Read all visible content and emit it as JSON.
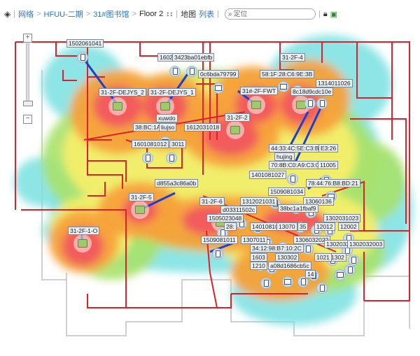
{
  "toolbar": {
    "breadcrumb": [
      {
        "label": "网络"
      },
      {
        "label": "HFUU-二期"
      },
      {
        "label": "31#图书馆"
      },
      {
        "label": "Floor 2"
      }
    ],
    "map_btn": "地图",
    "list_btn": "列表",
    "search_placeholder": "定位"
  },
  "aps": [
    {
      "name": "31-2F-DEJYS_2"
    },
    {
      "name": "31-2F-DEJYS_1"
    },
    {
      "name": "31#-2F-FWT"
    },
    {
      "name": "31-2F-4"
    },
    {
      "name": "31-2F-2"
    },
    {
      "name": "31-2F-5"
    },
    {
      "name": "31-2F-6"
    },
    {
      "name": "31-2F-1-O"
    }
  ],
  "clients": [
    {
      "name": "1502061041"
    },
    {
      "name": "1602"
    },
    {
      "name": "3423ba01ebfb"
    },
    {
      "name": "0c6bda79799"
    },
    {
      "name": "58:1F:28:C6:9E:3B"
    },
    {
      "name": "1314011026"
    },
    {
      "name": "8c18d9cdc10e"
    },
    {
      "name": "xuwdo"
    },
    {
      "name": "38:BC:1A"
    },
    {
      "name": "liujso"
    },
    {
      "name": "1612031018"
    },
    {
      "name": "1601081012"
    },
    {
      "name": "3011"
    },
    {
      "name": "44:33:4C:5E:C3:B9"
    },
    {
      "name": "E3:26"
    },
    {
      "name": "hujing"
    },
    {
      "name": "70:8B:C0:A9:C3:0C"
    },
    {
      "name": "11005"
    },
    {
      "name": "1401081027"
    },
    {
      "name": "78:44:76:B8:BD:21"
    },
    {
      "name": "d855a3c86a0b"
    },
    {
      "name": "1509081034"
    },
    {
      "name": "1312021031"
    },
    {
      "name": "13060136"
    },
    {
      "name": "d03311502c"
    },
    {
      "name": "38bc1a1fbaf9"
    },
    {
      "name": "1302031023"
    },
    {
      "name": "1505023048"
    },
    {
      "name": "28:"
    },
    {
      "name": "1401081013"
    },
    {
      "name": "13070"
    },
    {
      "name": "35"
    },
    {
      "name": "12012"
    },
    {
      "name": "12002"
    },
    {
      "name": "1509081011"
    },
    {
      "name": "1307011"
    },
    {
      "name": "1306032022"
    },
    {
      "name": "1302032049"
    },
    {
      "name": "1302032003"
    },
    {
      "name": "34:12:98:B7:10:2C"
    },
    {
      "name": "1603"
    },
    {
      "name": "130302"
    },
    {
      "name": "1302"
    },
    {
      "name": "1021"
    },
    {
      "name": "1210"
    },
    {
      "name": "a08d1686cb5c"
    },
    {
      "name": "14"
    }
  ],
  "colors": {
    "wall": "#e0202a",
    "hot": "#f25c5c",
    "warm": "#f6a13a",
    "mild": "#f4ee6a",
    "cool": "#a8e26c",
    "cold": "#7ae0e0",
    "link": "#1b3fd1"
  }
}
